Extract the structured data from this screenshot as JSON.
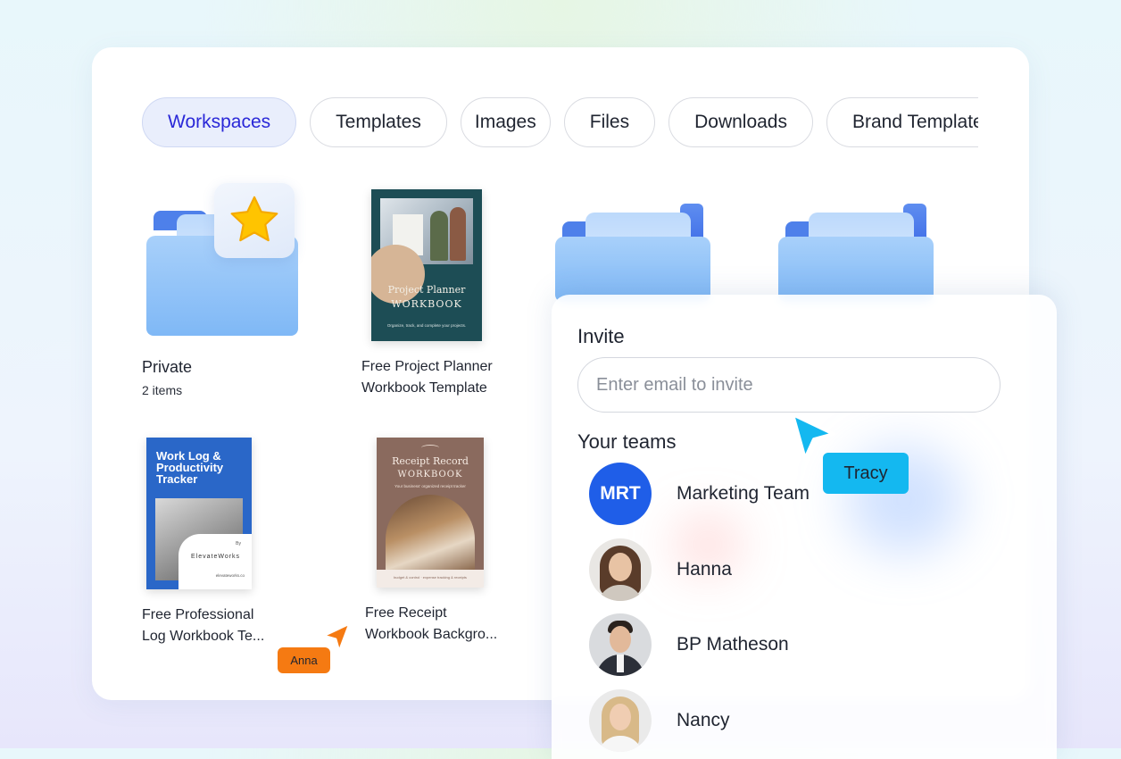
{
  "tabs": [
    {
      "label": "Workspaces",
      "active": true
    },
    {
      "label": "Templates"
    },
    {
      "label": "Images"
    },
    {
      "label": "Files"
    },
    {
      "label": "Downloads"
    },
    {
      "label": "Brand Templates"
    }
  ],
  "items": {
    "private": {
      "title": "Private",
      "subtitle": "2 items"
    },
    "project_planner": {
      "name_line1": "Free Project Planner",
      "name_line2": "Workbook Template",
      "thumb_title_line1": "Project Planner",
      "thumb_title_line2": "WORKBOOK",
      "thumb_caption": "Organize, track, and complete your projects."
    },
    "log_workbook": {
      "name_line1": "Free Professional",
      "name_line2": "Log Workbook Te...",
      "thumb_title": "Work Log & Productivity Tracker",
      "thumb_by": "By",
      "thumb_brand": "ElevateWorks",
      "thumb_site": "elevateworks.co"
    },
    "receipt_workbook": {
      "name_line1": "Free Receipt",
      "name_line2": "Workbook Backgro...",
      "thumb_title_line1": "Receipt Record",
      "thumb_title_line2": "WORKBOOK",
      "thumb_caption": "Your business' organized receipt tracker",
      "thumb_footer": "budget & control · expense tracking & receipts"
    }
  },
  "invite": {
    "title": "Invite",
    "placeholder": "Enter email to invite",
    "teams_title": "Your teams",
    "teams": [
      {
        "initials": "MRT",
        "name": "Marketing Team"
      },
      {
        "name": "Hanna"
      },
      {
        "name": "BP Matheson"
      },
      {
        "name": "Nancy"
      }
    ]
  },
  "cursors": [
    {
      "label": "Tracy",
      "color": "#14b8f0"
    },
    {
      "label": "Anna",
      "color": "#f57a12"
    }
  ],
  "colors": {
    "accent": "#2a28d8",
    "folder_blue": "#7fb8f6",
    "mrt_avatar": "#1f5ee8",
    "star": "#ffc400"
  }
}
